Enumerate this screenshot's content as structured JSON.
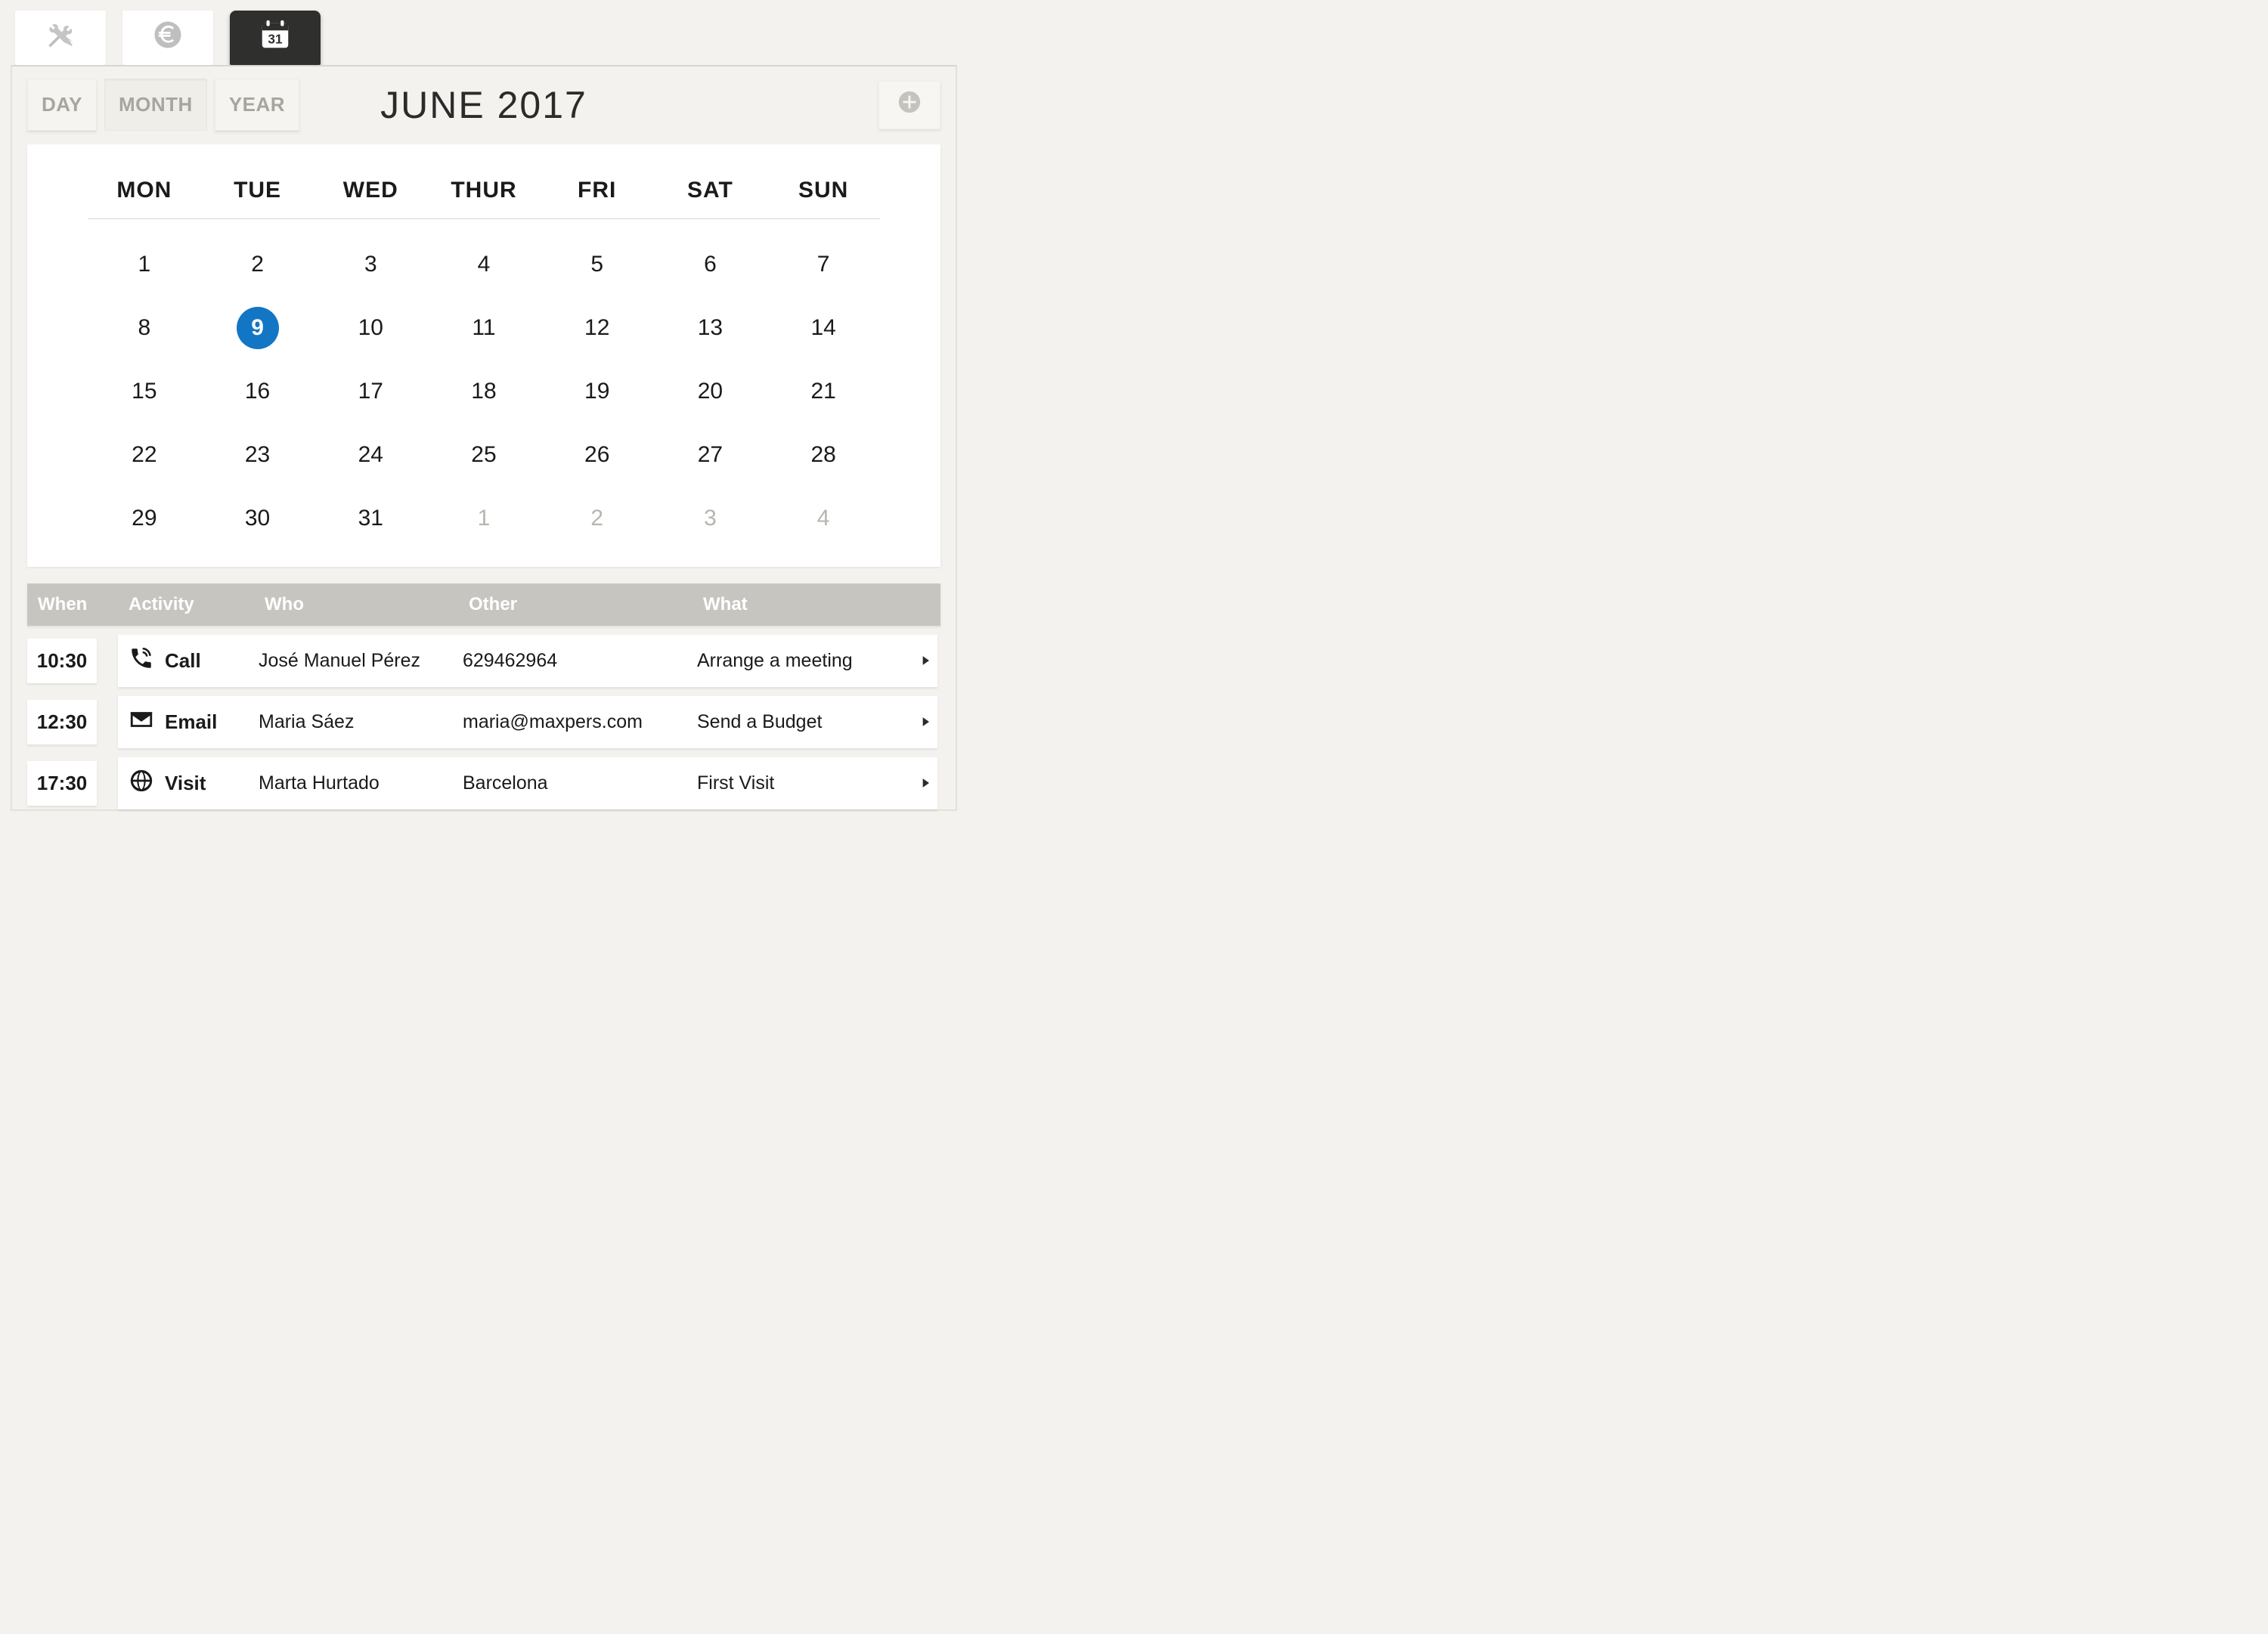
{
  "colors": {
    "accent": "#1276c4",
    "active_tab_bg": "#2f2f2d",
    "header_bar": "#c7c5bf"
  },
  "top_tabs": [
    {
      "id": "tools",
      "icon": "wrench-screwdriver-icon",
      "active": false
    },
    {
      "id": "money",
      "icon": "euro-icon",
      "active": false
    },
    {
      "id": "calendar",
      "icon": "calendar-31-icon",
      "active": true
    }
  ],
  "views": {
    "day": "DAY",
    "month": "MONTH",
    "year": "YEAR",
    "active": "month"
  },
  "title": "JUNE 2017",
  "calendar": {
    "dow": [
      "MON",
      "TUE",
      "WED",
      "THUR",
      "FRI",
      "SAT",
      "SUN"
    ],
    "selected": 9,
    "cells": [
      {
        "n": 1
      },
      {
        "n": 2
      },
      {
        "n": 3
      },
      {
        "n": 4
      },
      {
        "n": 5
      },
      {
        "n": 6
      },
      {
        "n": 7
      },
      {
        "n": 8
      },
      {
        "n": 9,
        "selected": true
      },
      {
        "n": 10
      },
      {
        "n": 11
      },
      {
        "n": 12
      },
      {
        "n": 13
      },
      {
        "n": 14
      },
      {
        "n": 15
      },
      {
        "n": 16
      },
      {
        "n": 17
      },
      {
        "n": 18
      },
      {
        "n": 19
      },
      {
        "n": 20
      },
      {
        "n": 21
      },
      {
        "n": 22
      },
      {
        "n": 23
      },
      {
        "n": 24
      },
      {
        "n": 25
      },
      {
        "n": 26
      },
      {
        "n": 27
      },
      {
        "n": 28
      },
      {
        "n": 29
      },
      {
        "n": 30
      },
      {
        "n": 31
      },
      {
        "n": 1,
        "muted": true
      },
      {
        "n": 2,
        "muted": true
      },
      {
        "n": 3,
        "muted": true
      },
      {
        "n": 4,
        "muted": true
      }
    ]
  },
  "agenda": {
    "headers": {
      "when": "When",
      "activity": "Activity",
      "who": "Who",
      "other": "Other",
      "what": "What"
    },
    "rows": [
      {
        "time": "10:30",
        "icon": "phone-icon",
        "activity": "Call",
        "who": "José Manuel Pérez",
        "other": "629462964",
        "what": "Arrange a meeting"
      },
      {
        "time": "12:30",
        "icon": "mail-icon",
        "activity": "Email",
        "who": "Maria Sáez",
        "other": "maria@maxpers.com",
        "what": "Send a Budget"
      },
      {
        "time": "17:30",
        "icon": "globe-icon",
        "activity": "Visit",
        "who": "Marta Hurtado",
        "other": "Barcelona",
        "what": "First Visit"
      }
    ]
  }
}
